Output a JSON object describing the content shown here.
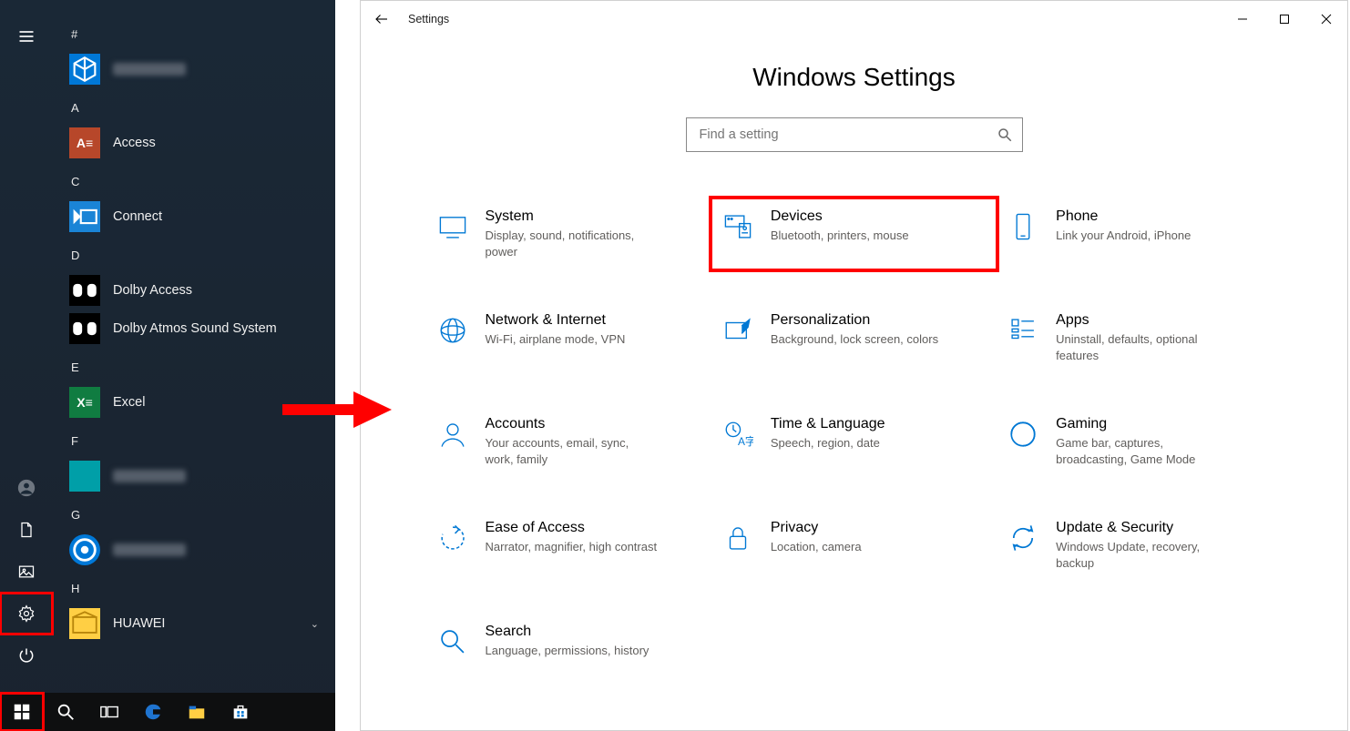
{
  "start_menu": {
    "sections": {
      "hash": {
        "header": "#",
        "apps": [
          {
            "label": "",
            "blurred": true,
            "icon": "ic-3d"
          }
        ]
      },
      "A": {
        "header": "A",
        "apps": [
          {
            "label": "Access",
            "icon": "ic-access"
          }
        ]
      },
      "C": {
        "header": "C",
        "apps": [
          {
            "label": "Connect",
            "icon": "ic-connect"
          }
        ]
      },
      "D": {
        "header": "D",
        "apps": [
          {
            "label": "Dolby Access",
            "icon": "ic-dolby"
          },
          {
            "label": "Dolby Atmos Sound System",
            "icon": "ic-dolby"
          }
        ]
      },
      "E": {
        "header": "E",
        "apps": [
          {
            "label": "Excel",
            "icon": "ic-excel"
          }
        ]
      },
      "F": {
        "header": "F",
        "apps": [
          {
            "label": "",
            "blurred": true,
            "icon": "ic-teal"
          }
        ]
      },
      "G": {
        "header": "G",
        "apps": [
          {
            "label": "",
            "blurred": true,
            "icon": "ic-groove"
          }
        ]
      },
      "H": {
        "header": "H",
        "apps": [
          {
            "label": "HUAWEI",
            "icon": "ic-huawei",
            "has_chevron": true
          }
        ]
      }
    }
  },
  "settings": {
    "titlebar_title": "Settings",
    "page_title": "Windows Settings",
    "search_placeholder": "Find a setting",
    "categories": [
      {
        "key": "system",
        "title": "System",
        "desc": "Display, sound, notifications, power"
      },
      {
        "key": "devices",
        "title": "Devices",
        "desc": "Bluetooth, printers, mouse",
        "highlighted": true
      },
      {
        "key": "phone",
        "title": "Phone",
        "desc": "Link your Android, iPhone"
      },
      {
        "key": "network",
        "title": "Network & Internet",
        "desc": "Wi-Fi, airplane mode, VPN"
      },
      {
        "key": "personal",
        "title": "Personalization",
        "desc": "Background, lock screen, colors"
      },
      {
        "key": "apps",
        "title": "Apps",
        "desc": "Uninstall, defaults, optional features"
      },
      {
        "key": "accounts",
        "title": "Accounts",
        "desc": "Your accounts, email, sync, work, family"
      },
      {
        "key": "time",
        "title": "Time & Language",
        "desc": "Speech, region, date"
      },
      {
        "key": "gaming",
        "title": "Gaming",
        "desc": "Game bar, captures, broadcasting, Game Mode"
      },
      {
        "key": "ease",
        "title": "Ease of Access",
        "desc": "Narrator, magnifier, high contrast"
      },
      {
        "key": "privacy",
        "title": "Privacy",
        "desc": "Location, camera"
      },
      {
        "key": "update",
        "title": "Update & Security",
        "desc": "Windows Update, recovery, backup"
      },
      {
        "key": "search",
        "title": "Search",
        "desc": "Language, permissions, history"
      }
    ]
  }
}
